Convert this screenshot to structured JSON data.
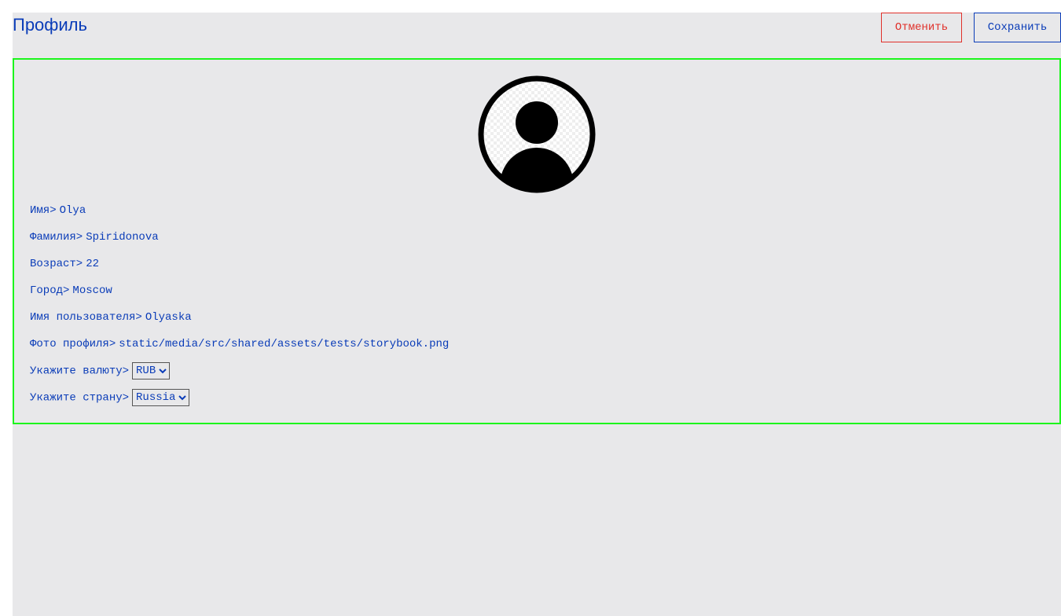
{
  "header": {
    "title": "Профиль",
    "cancel_label": "Отменить",
    "save_label": "Сохранить"
  },
  "profile": {
    "avatar_icon": "user-avatar-icon",
    "fields": {
      "first_name": {
        "label": "Имя>",
        "value": "Olya"
      },
      "last_name": {
        "label": "Фамилия>",
        "value": "Spiridonova"
      },
      "age": {
        "label": "Возраст>",
        "value": "22"
      },
      "city": {
        "label": "Город>",
        "value": "Moscow"
      },
      "username": {
        "label": "Имя пользователя>",
        "value": "Olyaska"
      },
      "avatar": {
        "label": "Фото профиля>",
        "value": "static/media/src/shared/assets/tests/storybook.png"
      }
    },
    "currency": {
      "label": "Укажите валюту>",
      "selected": "RUB"
    },
    "country": {
      "label": "Укажите страну>",
      "selected": "Russia"
    }
  },
  "colors": {
    "accent": "#0a3cb8",
    "danger": "#e0302a",
    "card_border": "#1cf51c",
    "background": "#e8e8ea"
  }
}
